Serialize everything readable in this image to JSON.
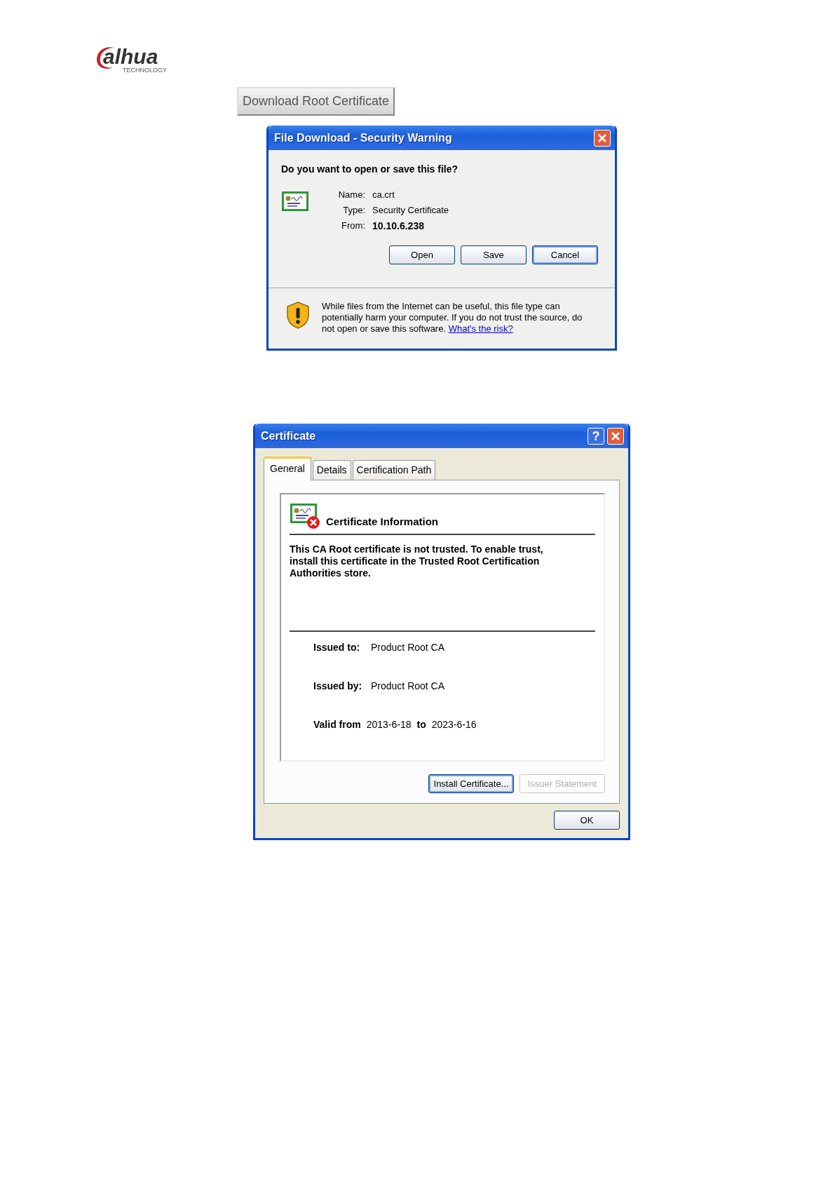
{
  "logo": {
    "text": "alhua",
    "tagline": "TECHNOLOGY"
  },
  "download_button": {
    "label": "Download Root Certificate"
  },
  "file_download_dialog": {
    "title": "File Download - Security Warning",
    "question": "Do you want to open or save this file?",
    "fields": [
      {
        "label": "Name:",
        "value": "ca.crt",
        "bold": false
      },
      {
        "label": "Type:",
        "value": "Security Certificate",
        "bold": false
      },
      {
        "label": "From:",
        "value": "10.10.6.238",
        "bold": true
      }
    ],
    "buttons": [
      {
        "label": "Open",
        "default": false
      },
      {
        "label": "Save",
        "default": false
      },
      {
        "label": "Cancel",
        "default": true
      }
    ],
    "warning": "While files from the Internet can be useful, this file type can potentially harm your computer. If you do not trust the source, do not open or save this software.",
    "risk_link": "What's the risk?"
  },
  "certificate_dialog": {
    "title": "Certificate",
    "help_button": "?",
    "tabs": [
      {
        "label": "General",
        "selected": true
      },
      {
        "label": "Details",
        "selected": false
      },
      {
        "label": "Certification Path",
        "selected": false
      }
    ],
    "info_title": "Certificate Information",
    "message": "This CA Root certificate is not trusted. To enable trust, install this certificate in the Trusted Root Certification Authorities store.",
    "issued_to": {
      "label": "Issued to:",
      "value": "Product Root CA"
    },
    "issued_by": {
      "label": "Issued by:",
      "value": "Product Root CA"
    },
    "valid": {
      "label": "Valid from",
      "from": "2013-6-18",
      "separator": "to",
      "to": "2023-6-16"
    },
    "buttons": [
      {
        "label": "Install Certificate...",
        "disabled": false,
        "default": true
      },
      {
        "label": "Issuer Statement",
        "disabled": true,
        "default": false
      }
    ],
    "ok_button": {
      "label": "OK"
    }
  }
}
